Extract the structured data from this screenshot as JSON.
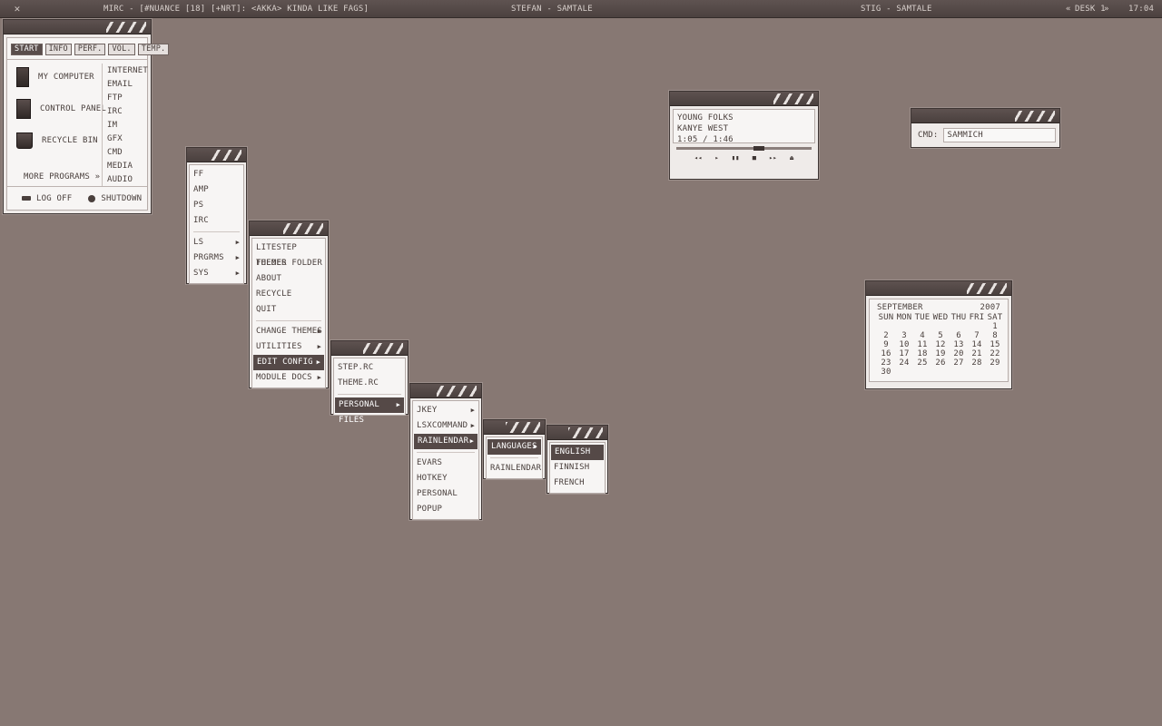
{
  "taskbar": {
    "app_icon": "x-logo-icon",
    "left_text": "MIRC - [#NUANCE [18] [+NRT]: <AKKA> KINDA LIKE FAGS]",
    "center_text": "STEFAN - SAMTALE",
    "right_text": "STIG - SAMTALE",
    "desk_prev": "«",
    "desk_label": "DESK 1",
    "desk_next": "»",
    "clock": "17:04"
  },
  "start_menu": {
    "tabs": [
      "START",
      "INFO",
      "PERF.",
      "VOL.",
      "TEMP."
    ],
    "items": [
      "MY COMPUTER",
      "CONTROL PANEL",
      "RECYCLE BIN"
    ],
    "net": [
      "INTERNET",
      "EMAIL",
      "FTP",
      "IRC",
      "IM",
      "GFX",
      "CMD",
      "MEDIA",
      "AUDIO"
    ],
    "more": "MORE PROGRAMS »",
    "logoff": "LOG OFF",
    "shutdown": "SHUTDOWN"
  },
  "menu1": {
    "a": [
      "FF",
      "AMP",
      "PS",
      "IRC"
    ],
    "b": [
      "LS",
      "PRGRMS",
      "SYS"
    ]
  },
  "menu2": {
    "a": [
      "LITESTEP FOLDER",
      "THEMES FOLDER",
      "ABOUT",
      "RECYCLE",
      "QUIT"
    ],
    "b": [
      "CHANGE THEMES",
      "UTILITIES",
      "EDIT CONFIG",
      "MODULE DOCS"
    ]
  },
  "menu3": {
    "a": [
      "STEP.RC",
      "THEME.RC"
    ],
    "b": [
      "PERSONAL FILES"
    ]
  },
  "menu4": {
    "a": [
      "JKEY",
      "LSXCOMMAND",
      "RAINLENDAR"
    ],
    "b": [
      "EVARS",
      "HOTKEY",
      "PERSONAL",
      "POPUP"
    ]
  },
  "menu5": {
    "a": [
      "LANGUAGES"
    ],
    "b": [
      "RAINLENDAR"
    ]
  },
  "menu6": {
    "a": [
      "ENGLISH",
      "FINNISH",
      "FRENCH"
    ]
  },
  "player": {
    "track": "YOUNG FOLKS",
    "artist": "KANYE WEST",
    "time": "1:05 / 1:46",
    "progress": 0.61,
    "controls": [
      "◂◂",
      "▸",
      "▮▮",
      "■",
      "▸▸",
      "⏏"
    ]
  },
  "cmd": {
    "label": "CMD:",
    "value": "SAMMICH"
  },
  "calendar": {
    "month": "SEPTEMBER",
    "year": "2007",
    "days": [
      "SUN",
      "MON",
      "TUE",
      "WED",
      "THU",
      "FRI",
      "SAT"
    ],
    "rows": [
      [
        "",
        "",
        "",
        "",
        "",
        "",
        "1"
      ],
      [
        "2",
        "3",
        "4",
        "5",
        "6",
        "7",
        "8"
      ],
      [
        "9",
        "10",
        "11",
        "12",
        "13",
        "14",
        "15"
      ],
      [
        "16",
        "17",
        "18",
        "19",
        "20",
        "21",
        "22"
      ],
      [
        "23",
        "24",
        "25",
        "26",
        "27",
        "28",
        "29"
      ],
      [
        "30",
        "",
        "",
        "",
        "",
        "",
        ""
      ]
    ]
  }
}
